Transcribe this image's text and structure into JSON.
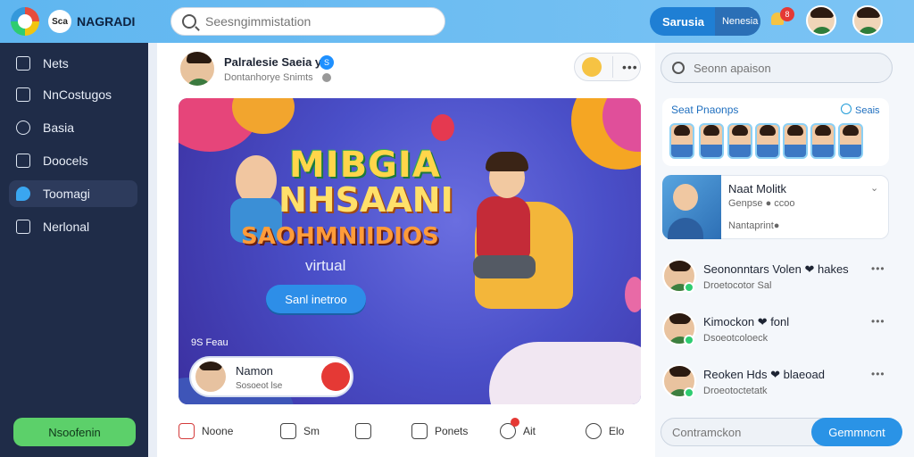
{
  "app": {
    "logo_text": "Sca",
    "brand": "NAGRADI"
  },
  "search": {
    "placeholder": "Seesngimmistation"
  },
  "header": {
    "primary_button": "Sarusia",
    "secondary_button": "Nenesia",
    "notification_count": "8"
  },
  "sidebar": {
    "items": [
      {
        "label": "Nets",
        "icon": "square-icon"
      },
      {
        "label": "NnCostugos",
        "icon": "edit-icon"
      },
      {
        "label": "Basia",
        "icon": "link-icon"
      },
      {
        "label": "Doocels",
        "icon": "document-icon"
      },
      {
        "label": "Toomagi",
        "icon": "bird-icon",
        "active": true
      },
      {
        "label": "Nerlonal",
        "icon": "card-icon"
      }
    ],
    "bottom_button": "Nsoofenin"
  },
  "post": {
    "author": "Palralesie Saeia y",
    "verified": "S",
    "subtitle": "Dontanhorye Snimts",
    "banner": {
      "title_line1": "MIBGIA",
      "title_line2": "NHSAANI",
      "title_line3": "SAOHMNIIDIOS",
      "subtitle": "virtual",
      "button": "Sanl inetroo",
      "tag": "9S Feau",
      "mini_card": {
        "name": "Namon",
        "status": "Sosoeot lse"
      }
    },
    "actions": [
      {
        "label": "Noone"
      },
      {
        "label": "Sm"
      },
      {
        "label": ""
      },
      {
        "label": "Ponets"
      },
      {
        "label": "Ait"
      },
      {
        "label": "Elo"
      }
    ]
  },
  "right": {
    "search_placeholder": "Seonn apaison",
    "stories_title": "Seat Pnaonps",
    "stories_link": "Seais",
    "feature": {
      "title": "Naat Molitk",
      "line1": "Genpse ● ccoo",
      "line2": "Nantaprint●"
    },
    "friends": [
      {
        "name": "Seononntars Volen ❤ hakes",
        "status": "Droetocotor Sal"
      },
      {
        "name": "Kimockon ❤ fonl",
        "status": "Dsoeotcoloeck"
      },
      {
        "name": "Reoken Hds ❤ blaeoad",
        "status": "Droeotoctetatk"
      }
    ],
    "comment_placeholder": "Contramckon",
    "comment_button": "Gemmncnt"
  }
}
